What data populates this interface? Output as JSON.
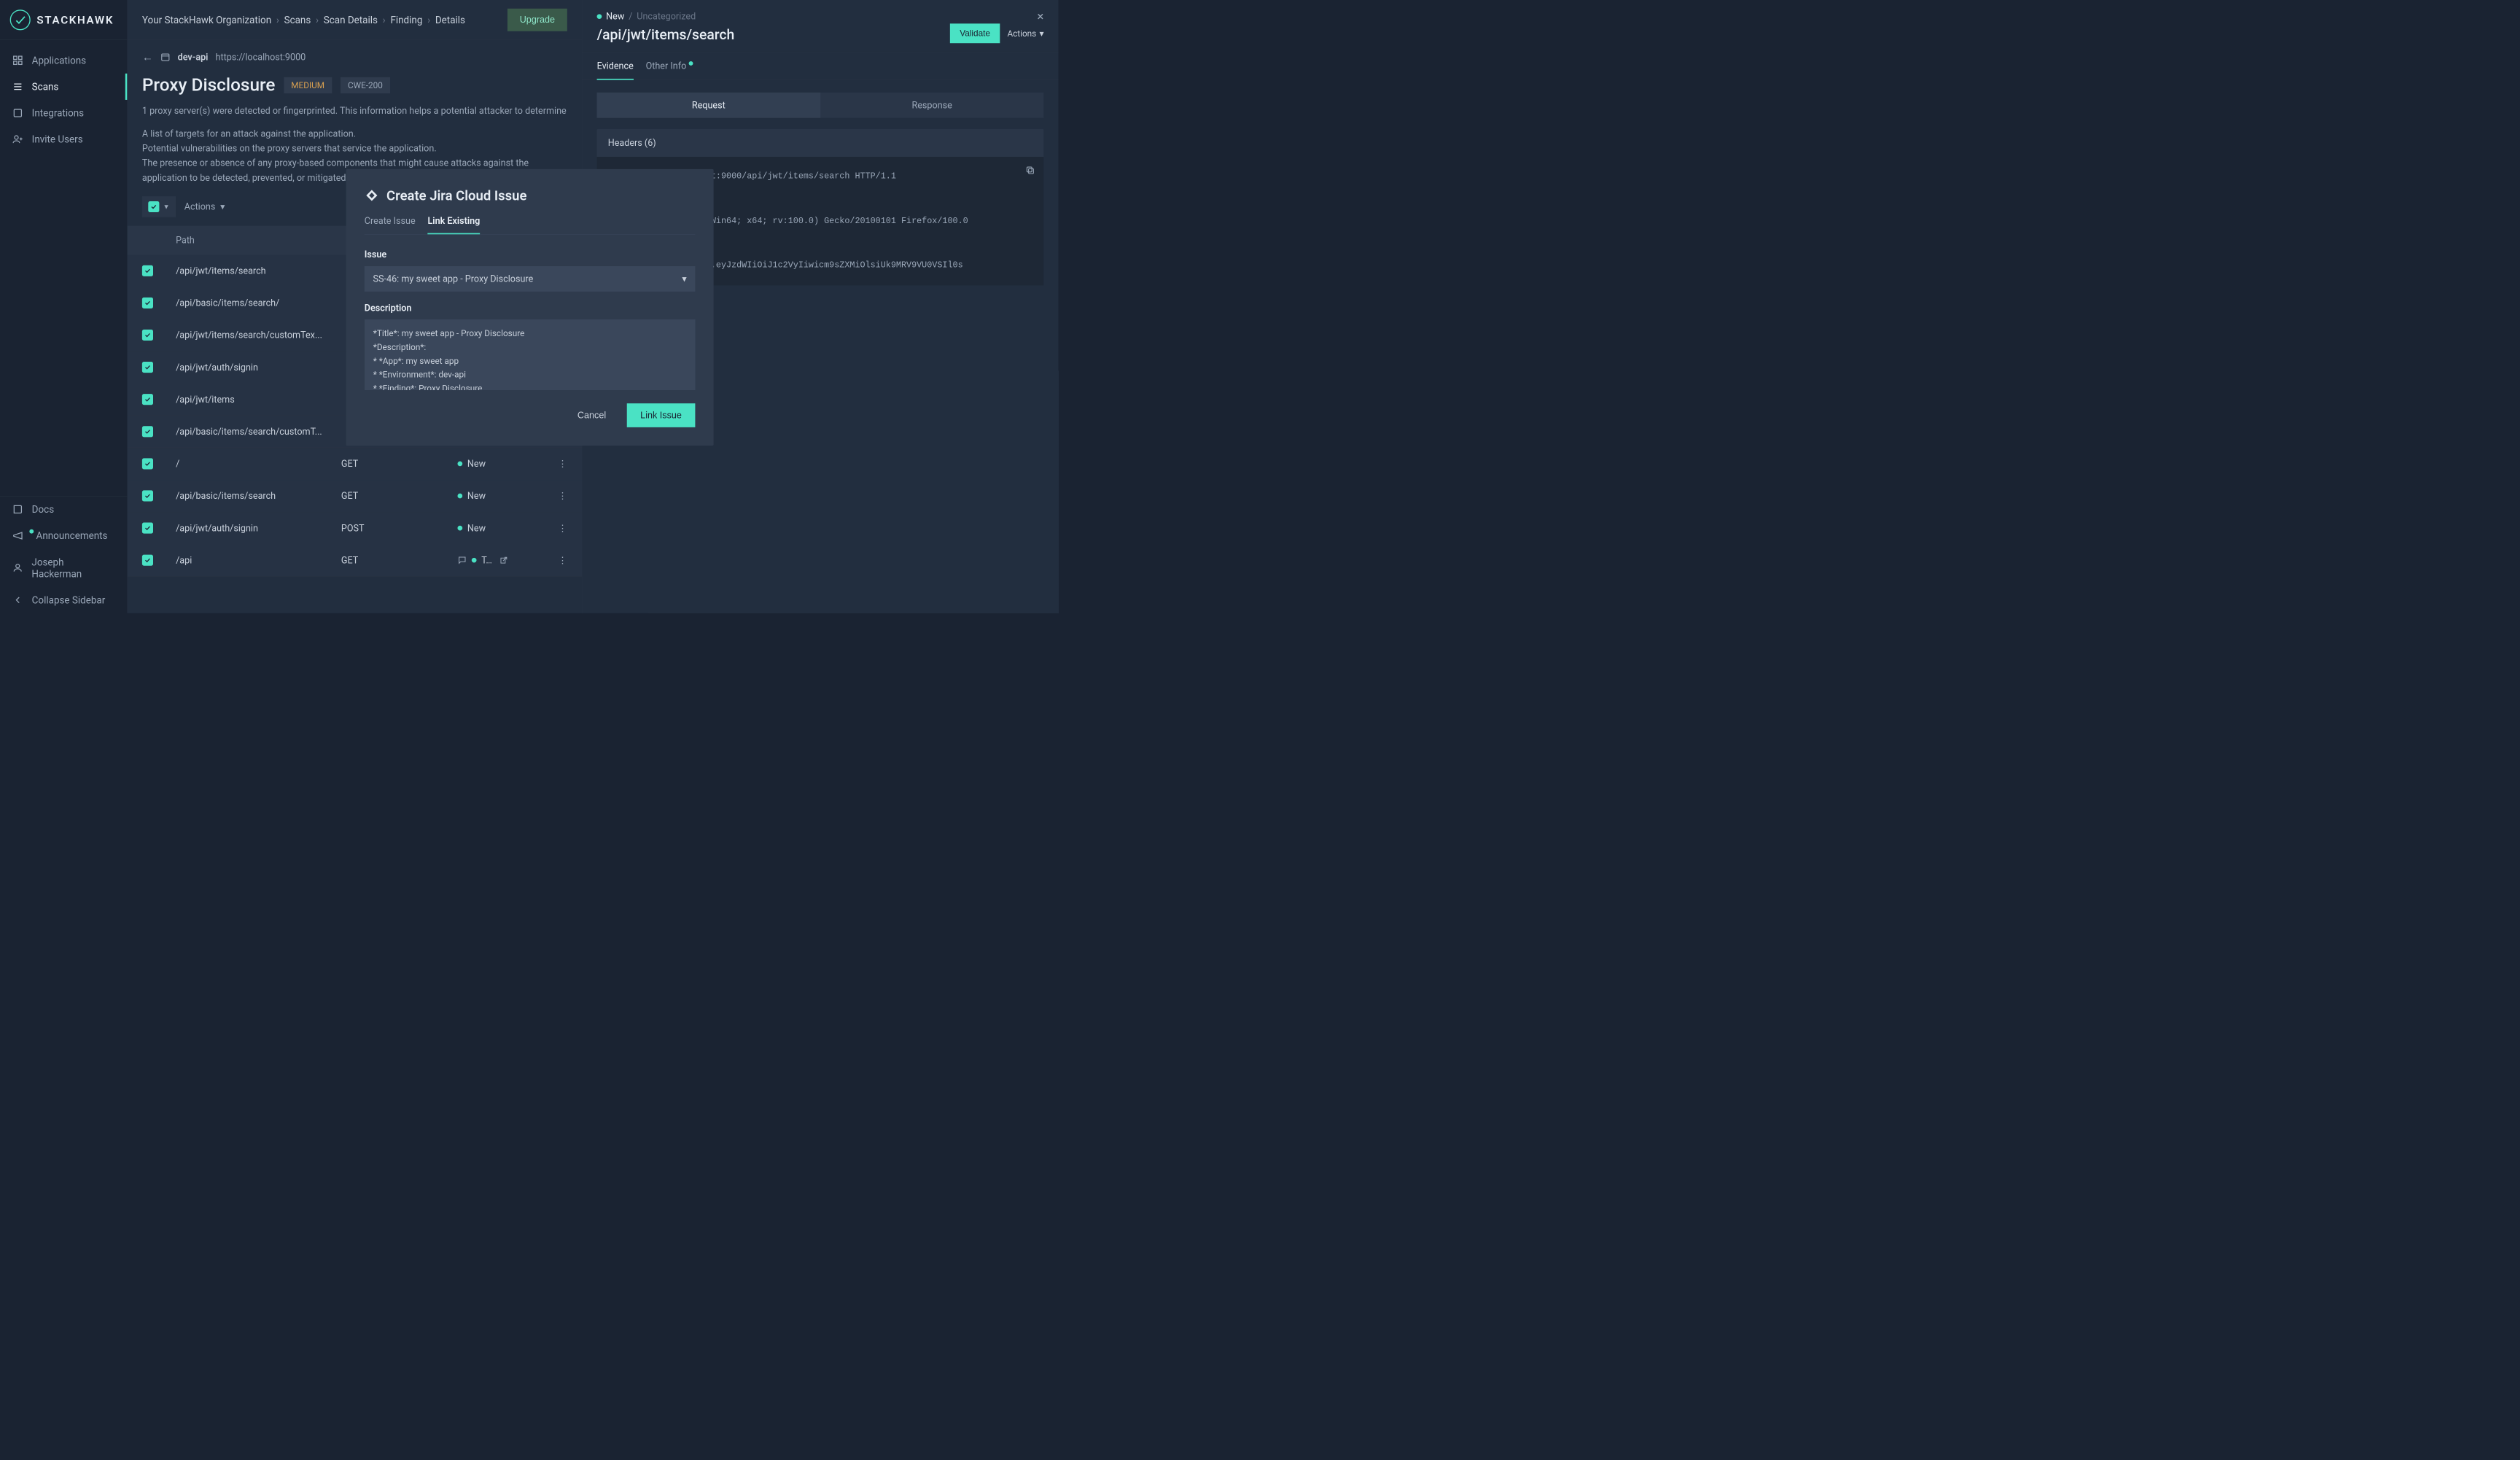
{
  "brand": "STACKHAWK",
  "sidebar": {
    "nav": [
      {
        "label": "Applications"
      },
      {
        "label": "Scans"
      },
      {
        "label": "Integrations"
      },
      {
        "label": "Invite Users"
      }
    ],
    "bottom": [
      {
        "label": "Docs"
      },
      {
        "label": "Announcements"
      },
      {
        "label": "Joseph Hackerman"
      },
      {
        "label": "Collapse Sidebar"
      }
    ]
  },
  "breadcrumbs": [
    "Your StackHawk Organization",
    "Scans",
    "Scan Details",
    "Finding",
    "Details"
  ],
  "upgrade": "Upgrade",
  "env": {
    "name": "dev-api",
    "url": "https://localhost:9000"
  },
  "finding": {
    "title": "Proxy Disclosure",
    "severity": "MEDIUM",
    "cwe": "CWE-200",
    "summary": "1 proxy server(s) were detected or fingerprinted. This information helps a potential attacker to determine",
    "desc": "A list of targets for an attack against the application.\nPotential vulnerabilities on the proxy servers that service the application.\nThe presence or absence of any proxy-based components that might cause attacks against the application to be detected, prevented, or mitigated."
  },
  "actions_label": "Actions",
  "table": {
    "header": "Path",
    "rows": [
      {
        "path": "/api/jwt/items/search",
        "method": "",
        "status": ""
      },
      {
        "path": "/api/basic/items/search/",
        "method": "",
        "status": ""
      },
      {
        "path": "/api/jwt/items/search/customTex...",
        "method": "",
        "status": ""
      },
      {
        "path": "/api/jwt/auth/signin",
        "method": "",
        "status": ""
      },
      {
        "path": "/api/jwt/items",
        "method": "",
        "status": ""
      },
      {
        "path": "/api/basic/items/search/customT...",
        "method": "",
        "status": ""
      },
      {
        "path": "/",
        "method": "GET",
        "status": "New"
      },
      {
        "path": "/api/basic/items/search",
        "method": "GET",
        "status": "New"
      },
      {
        "path": "/api/jwt/auth/signin",
        "method": "POST",
        "status": "New"
      },
      {
        "path": "/api",
        "method": "GET",
        "status": "T…",
        "has_comment": true,
        "has_ext": true
      }
    ]
  },
  "right": {
    "status_new": "New",
    "sep": "/",
    "uncat": "Uncategorized",
    "path": "/api/jwt/items/search",
    "validate": "Validate",
    "actions": "Actions",
    "tabs": [
      "Evidence",
      "Other Info"
    ],
    "seg": [
      "Request",
      "Response"
    ],
    "headers_title": "Headers (6)",
    "code": "GET https://localhost:9000/api/jwt/items/search HTTP/1.1\n\n0 (Windows NT 10.0; Win64; x64; rv:100.0) Gecko/20100101 Firefox/100.0\ne\neyJhbGciOiJIUzI1NiJ9.eyJzdWIiOiJ1c2VyIiwicm9sZXMiOlsiUk9MRV9VU0VSIl0s"
  },
  "modal": {
    "title": "Create Jira Cloud Issue",
    "tabs": [
      "Create Issue",
      "Link Existing"
    ],
    "issue_label": "Issue",
    "issue_value": "SS-46: my sweet app - Proxy Disclosure",
    "desc_label": "Description",
    "desc_value": "*Title*: my sweet app - Proxy Disclosure\n*Description*:\n* *App*: my sweet app\n* *Environment*: dev-api\n* *Finding*: Proxy Disclosure\n* *Criticality*: Medium",
    "cancel": "Cancel",
    "submit": "Link Issue"
  }
}
